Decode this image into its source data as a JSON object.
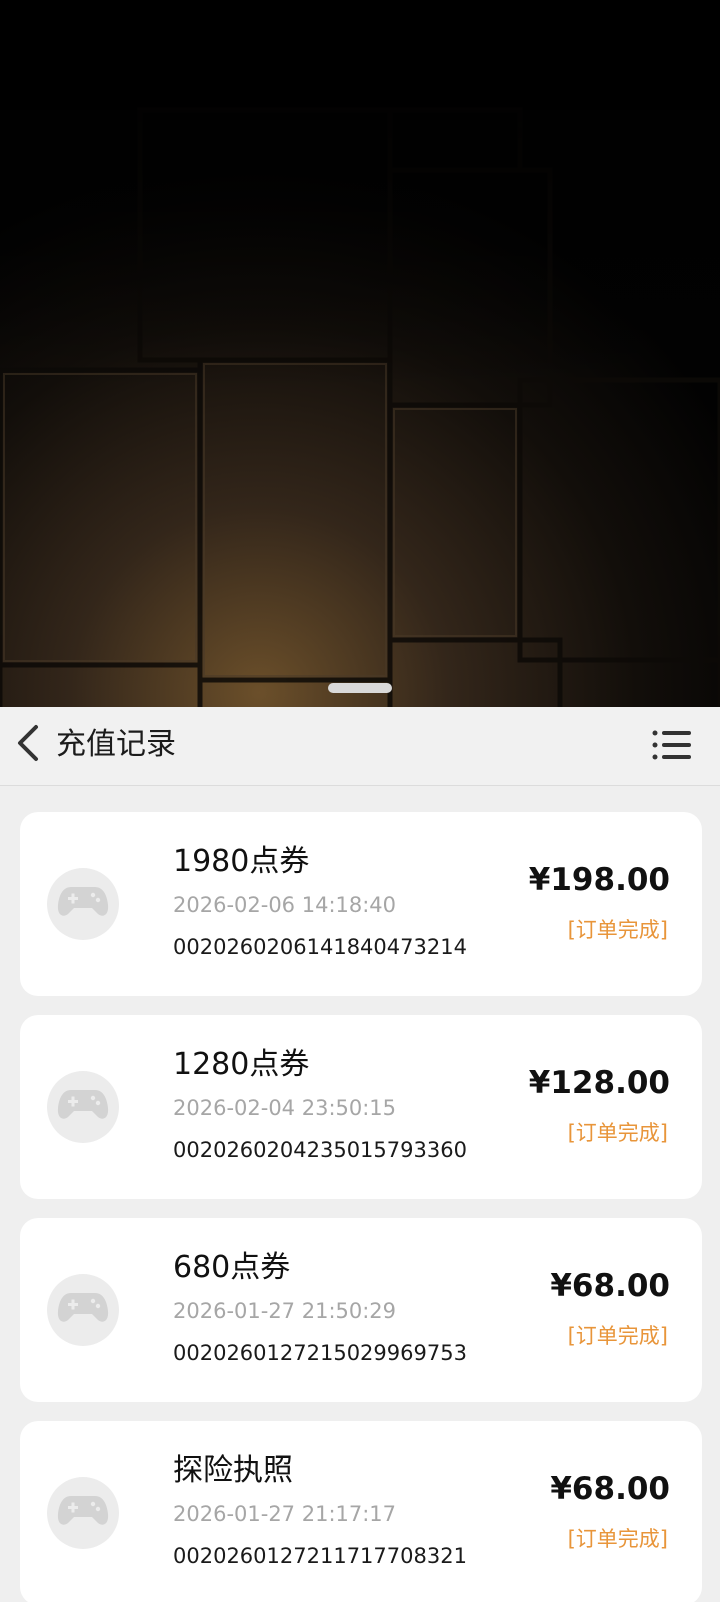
{
  "header": {
    "title": "充值记录",
    "back_icon": "chevron-left-icon",
    "menu_icon": "list-menu-icon"
  },
  "records": [
    {
      "name": "1980点券",
      "time": "2026-02-06 14:18:40",
      "order_no": "0020260206141840473214",
      "price": "¥198.00",
      "status": "[订单完成]",
      "icon": "gamepad-icon"
    },
    {
      "name": "1280点券",
      "time": "2026-02-04 23:50:15",
      "order_no": "0020260204235015793360",
      "price": "¥128.00",
      "status": "[订单完成]",
      "icon": "gamepad-icon"
    },
    {
      "name": "680点券",
      "time": "2026-01-27 21:50:29",
      "order_no": "0020260127215029969753",
      "price": "¥68.00",
      "status": "[订单完成]",
      "icon": "gamepad-icon"
    },
    {
      "name": "探险执照",
      "time": "2026-01-27 21:17:17",
      "order_no": "0020260127211717708321",
      "price": "¥68.00",
      "status": "[订单完成]",
      "icon": "gamepad-icon"
    }
  ],
  "colors": {
    "status": "#e8953a",
    "panel_bg": "#efefef",
    "card_bg": "#ffffff"
  }
}
